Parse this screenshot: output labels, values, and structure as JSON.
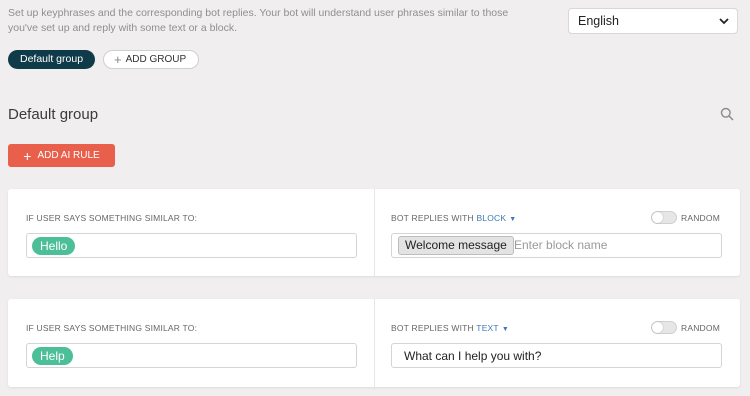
{
  "header": {
    "description": "Set up keyphrases and the corresponding bot replies. Your bot will understand user phrases similar to those you've set up and reply with some text or a block.",
    "language_selected": "English"
  },
  "groups": {
    "active_label": "Default group",
    "add_label": "ADD GROUP"
  },
  "section": {
    "title": "Default group",
    "add_ai_rule_label": "ADD AI RULE"
  },
  "rules": [
    {
      "user_says_label": "IF USER SAYS SOMETHING SIMILAR TO:",
      "phrase": "Hello",
      "bot_replies_prefix": "BOT REPLIES WITH",
      "bot_replies_type": "BLOCK",
      "random_label": "RANDOM",
      "random_enabled": false,
      "block_name": "Welcome message",
      "block_placeholder": "Enter block name"
    },
    {
      "user_says_label": "IF USER SAYS SOMETHING SIMILAR TO:",
      "phrase": "Help",
      "bot_replies_prefix": "BOT REPLIES WITH",
      "bot_replies_type": "TEXT",
      "random_label": "RANDOM",
      "random_enabled": false,
      "reply_text": "What can I help you with?"
    }
  ],
  "colors": {
    "background": "#f0eeee",
    "dark_pill": "#0f3a4a",
    "ai_button": "#e8604c",
    "phrase_tag": "#4cbf99",
    "link_blue": "#3d7ab8"
  },
  "icons": {
    "language_dropdown": "chevron-down-icon",
    "add_group": "plus-icon",
    "search": "search-icon",
    "add_ai_rule": "plus-icon",
    "reply_type_caret": "caret-down-icon"
  }
}
